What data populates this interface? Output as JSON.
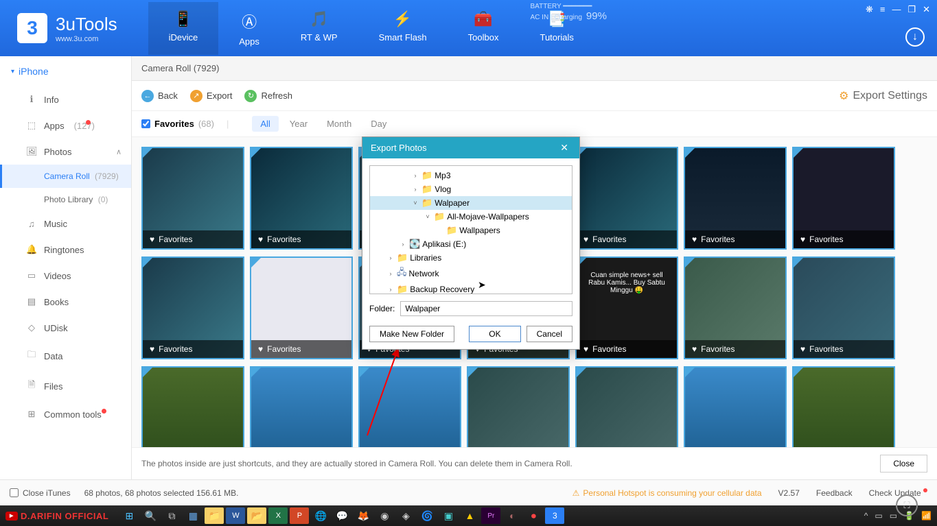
{
  "app": {
    "name": "3uTools",
    "url": "www.3u.com"
  },
  "nav": [
    {
      "label": "iDevice",
      "icon": "📱"
    },
    {
      "label": "Apps",
      "icon": "Ⓐ"
    },
    {
      "label": "RT & WP",
      "icon": "🎵"
    },
    {
      "label": "Smart Flash",
      "icon": "⚡"
    },
    {
      "label": "Toolbox",
      "icon": "🧰"
    },
    {
      "label": "Tutorials",
      "icon": "📑"
    }
  ],
  "battery": {
    "label": "BATTERY",
    "status": "AC IN  |  Charging",
    "pct": "99%"
  },
  "sidebar": {
    "device": "iPhone",
    "items": [
      {
        "label": "Info",
        "icon": "ℹ"
      },
      {
        "label": "Apps",
        "count": "(127)",
        "icon": "⬚",
        "dot": true
      },
      {
        "label": "Photos",
        "icon": "🖼",
        "expand": true
      },
      {
        "label": "Music",
        "icon": "♫"
      },
      {
        "label": "Ringtones",
        "icon": "🔔"
      },
      {
        "label": "Videos",
        "icon": "▭"
      },
      {
        "label": "Books",
        "icon": "▤"
      },
      {
        "label": "UDisk",
        "icon": "◇"
      },
      {
        "label": "Data",
        "icon": "🗀"
      },
      {
        "label": "Files",
        "icon": "🗎"
      },
      {
        "label": "Common tools",
        "icon": "⊞",
        "dot": true
      }
    ],
    "sub": [
      {
        "label": "Camera Roll",
        "count": "(7929)",
        "active": true
      },
      {
        "label": "Photo Library",
        "count": "(0)"
      }
    ]
  },
  "breadcrumb": "Camera Roll (7929)",
  "toolbar": {
    "back": "Back",
    "export": "Export",
    "refresh": "Refresh",
    "settings": "Export Settings"
  },
  "filter": {
    "fav": "Favorites",
    "favcount": "(68)",
    "tabs": [
      "All",
      "Year",
      "Month",
      "Day"
    ]
  },
  "fav_label": "Favorites",
  "promo_text": "Cuan simple news+ sell Rabu Kamis... Buy Sabtu Minggu 🤑",
  "info": "The photos inside are just shortcuts, and they are actually stored in Camera Roll. You can delete them in Camera Roll.",
  "close": "Close",
  "status": {
    "itunes": "Close iTunes",
    "selection": "68 photos, 68 photos selected 156.61 MB.",
    "warn": "Personal Hotspot is consuming your cellular data",
    "version": "V2.57",
    "feedback": "Feedback",
    "update": "Check Update"
  },
  "dialog": {
    "title": "Export Photos",
    "tree": [
      {
        "label": "Mp3",
        "indent": 3,
        "arrow": ">",
        "icon": "folder"
      },
      {
        "label": "Vlog",
        "indent": 3,
        "arrow": ">",
        "icon": "folder"
      },
      {
        "label": "Walpaper",
        "indent": 3,
        "arrow": "v",
        "icon": "folder",
        "sel": true
      },
      {
        "label": "All-Mojave-Wallpapers",
        "indent": 4,
        "arrow": "v",
        "icon": "folder"
      },
      {
        "label": "Wallpapers",
        "indent": 5,
        "arrow": "",
        "icon": "folder"
      },
      {
        "label": "Aplikasi (E:)",
        "indent": 2,
        "arrow": ">",
        "icon": "drive"
      },
      {
        "label": "Libraries",
        "indent": 1,
        "arrow": ">",
        "icon": "folder"
      },
      {
        "label": "Network",
        "indent": 1,
        "arrow": ">",
        "icon": "net"
      },
      {
        "label": "Backup Recovery",
        "indent": 1,
        "arrow": ">",
        "icon": "folder"
      }
    ],
    "folder_label": "Folder:",
    "folder_value": "Walpaper",
    "btn_new": "Make New Folder",
    "btn_ok": "OK",
    "btn_cancel": "Cancel"
  },
  "taskbar": {
    "brand": "D.ARIFIN OFFICIAL"
  }
}
